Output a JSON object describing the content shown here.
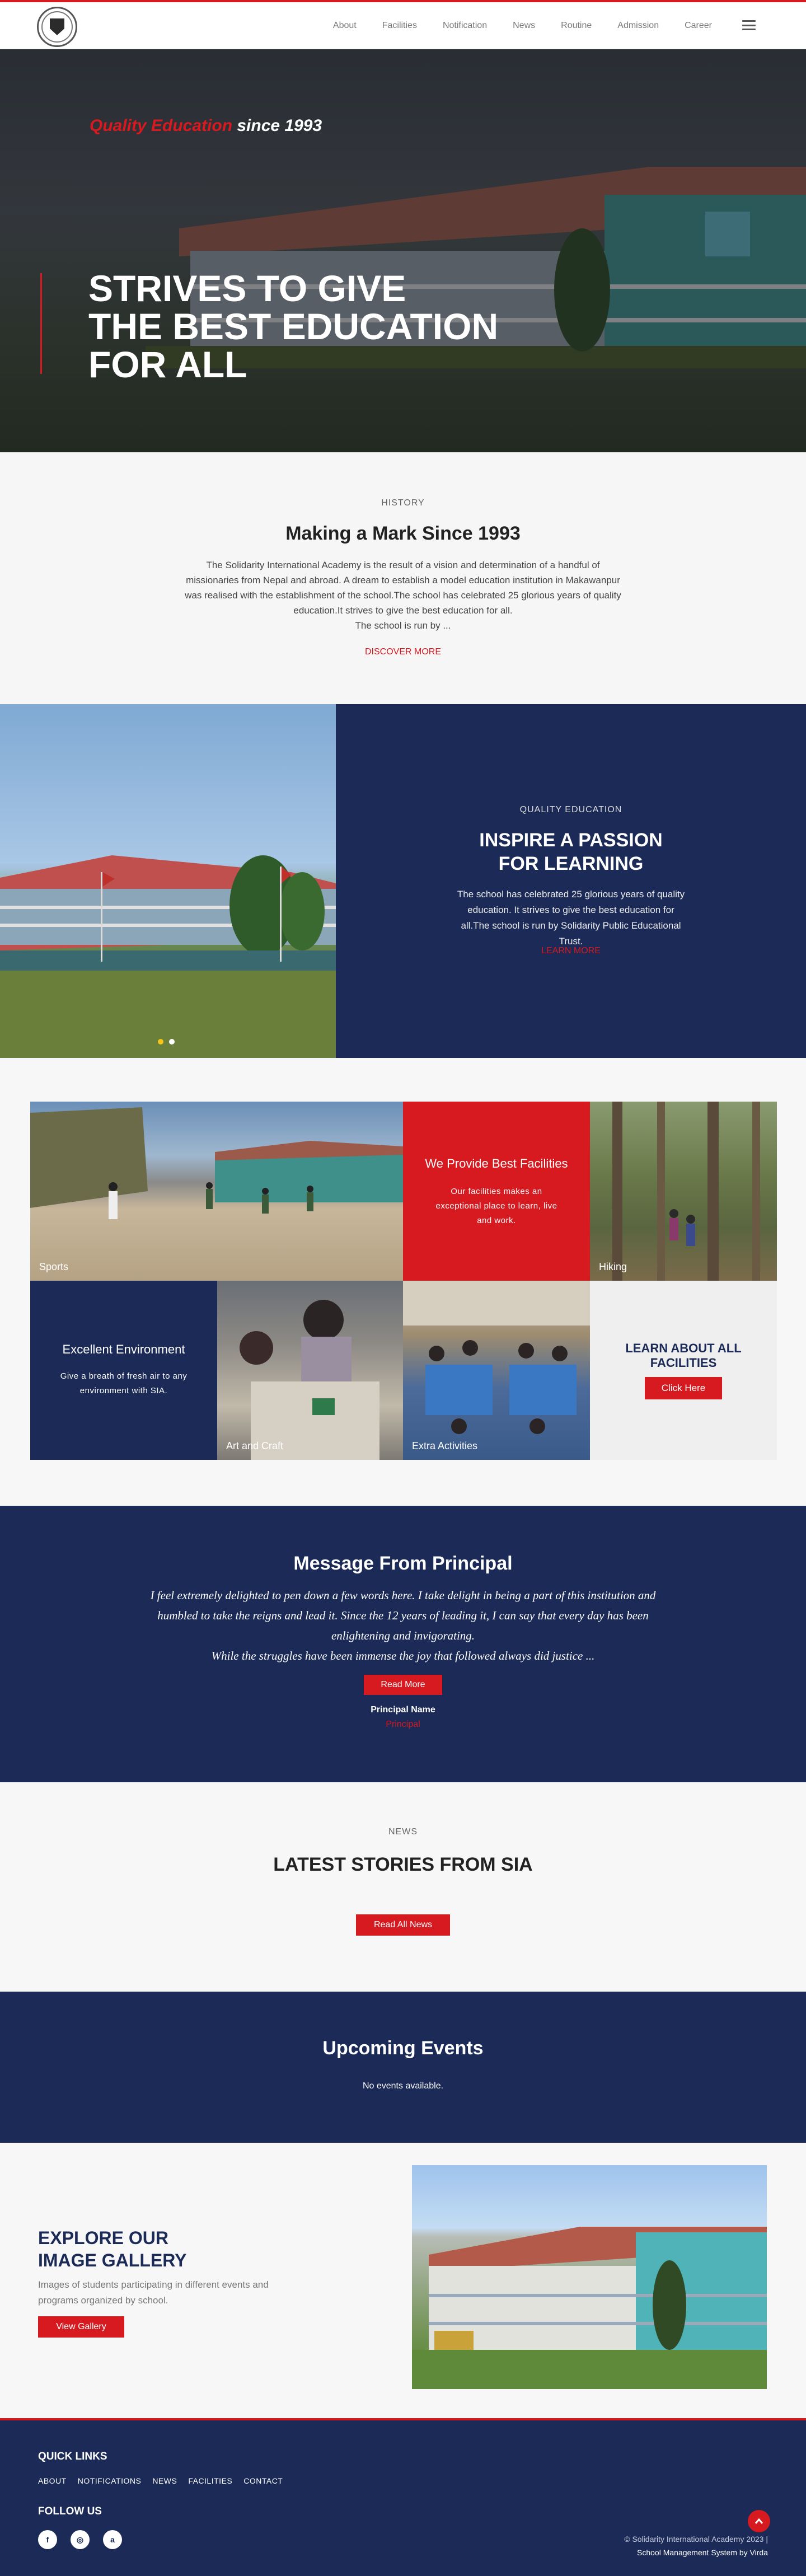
{
  "nav": {
    "logo_alt": "Solidarity International Academy logo",
    "items": [
      "About",
      "Facilities",
      "Notification",
      "News",
      "Routine",
      "Admission",
      "Career"
    ]
  },
  "hero": {
    "tagline_accent": "Quality Education",
    "tagline_rest": " since 1993",
    "title_lines": [
      "STRIVES TO GIVE",
      "THE BEST EDUCATION",
      "FOR ALL"
    ]
  },
  "history": {
    "eyebrow": "HISTORY",
    "title": "Making a Mark Since 1993",
    "body": "The Solidarity International Academy is the result of a vision and determination of a handful of missionaries from Nepal  and abroad. A dream to establish a model education institution in Makawanpur was realised with the establishment of the school.The school has  celebrated 25 glorious years of quality education.It strives to give the best education for all.",
    "body_tail": "The school is run by ...",
    "link": "DISCOVER MORE"
  },
  "inspire": {
    "eyebrow": "QUALITY EDUCATION",
    "title_lines": [
      "INSPIRE A PASSION",
      "FOR LEARNING"
    ],
    "body": "The school has celebrated 25 glorious years of quality education. It strives to give the best education for all.The school is run by Solidarity Public Educational Trust.",
    "link": "LEARN MORE"
  },
  "facilities": {
    "sports": "Sports",
    "provide_title": "We Provide Best Facilities",
    "provide_body": "Our facilities makes an exceptional place to learn, live and work.",
    "hiking": "Hiking",
    "env_title": "Excellent Environment",
    "env_body": "Give a breath of fresh air to any environment with SIA.",
    "art": "Art and Craft",
    "extra": "Extra Activities",
    "learn_title": "LEARN ABOUT ALL FACILITIES",
    "learn_button": "Click Here"
  },
  "principal": {
    "title": "Message From Principal",
    "quote": "I feel extremely delighted to pen down a few words here. I take delight in being a part of this institution and humbled to take the reigns and lead it. Since the 12 years of leading it, I can say that every day has been enlightening and invigorating.",
    "quote_tail": "While the struggles have been immense the joy that followed always did justice ...",
    "button": "Read More",
    "name": "Principal Name",
    "role": "Principal"
  },
  "news": {
    "eyebrow": "NEWS",
    "title": "LATEST STORIES FROM SIA",
    "button": "Read All News"
  },
  "events": {
    "title": "Upcoming Events",
    "empty": "No events available."
  },
  "gallery": {
    "title_lines": [
      "EXPLORE OUR",
      "IMAGE GALLERY"
    ],
    "body": "Images of students participating in different events and programs organized by school.",
    "button": "View Gallery"
  },
  "footer": {
    "quick_title": "QUICK LINKS",
    "links": [
      "ABOUT",
      "NOTIFICATIONS",
      "NEWS",
      "FACILITIES",
      "CONTACT"
    ],
    "follow_title": "FOLLOW US",
    "social": [
      "f",
      "◎",
      "a"
    ],
    "copyright": "© Solidarity International Academy 2023 |",
    "powered": "School Management System by Virda"
  },
  "colors": {
    "brand_red": "#d71920",
    "navy": "#1b2a57"
  }
}
